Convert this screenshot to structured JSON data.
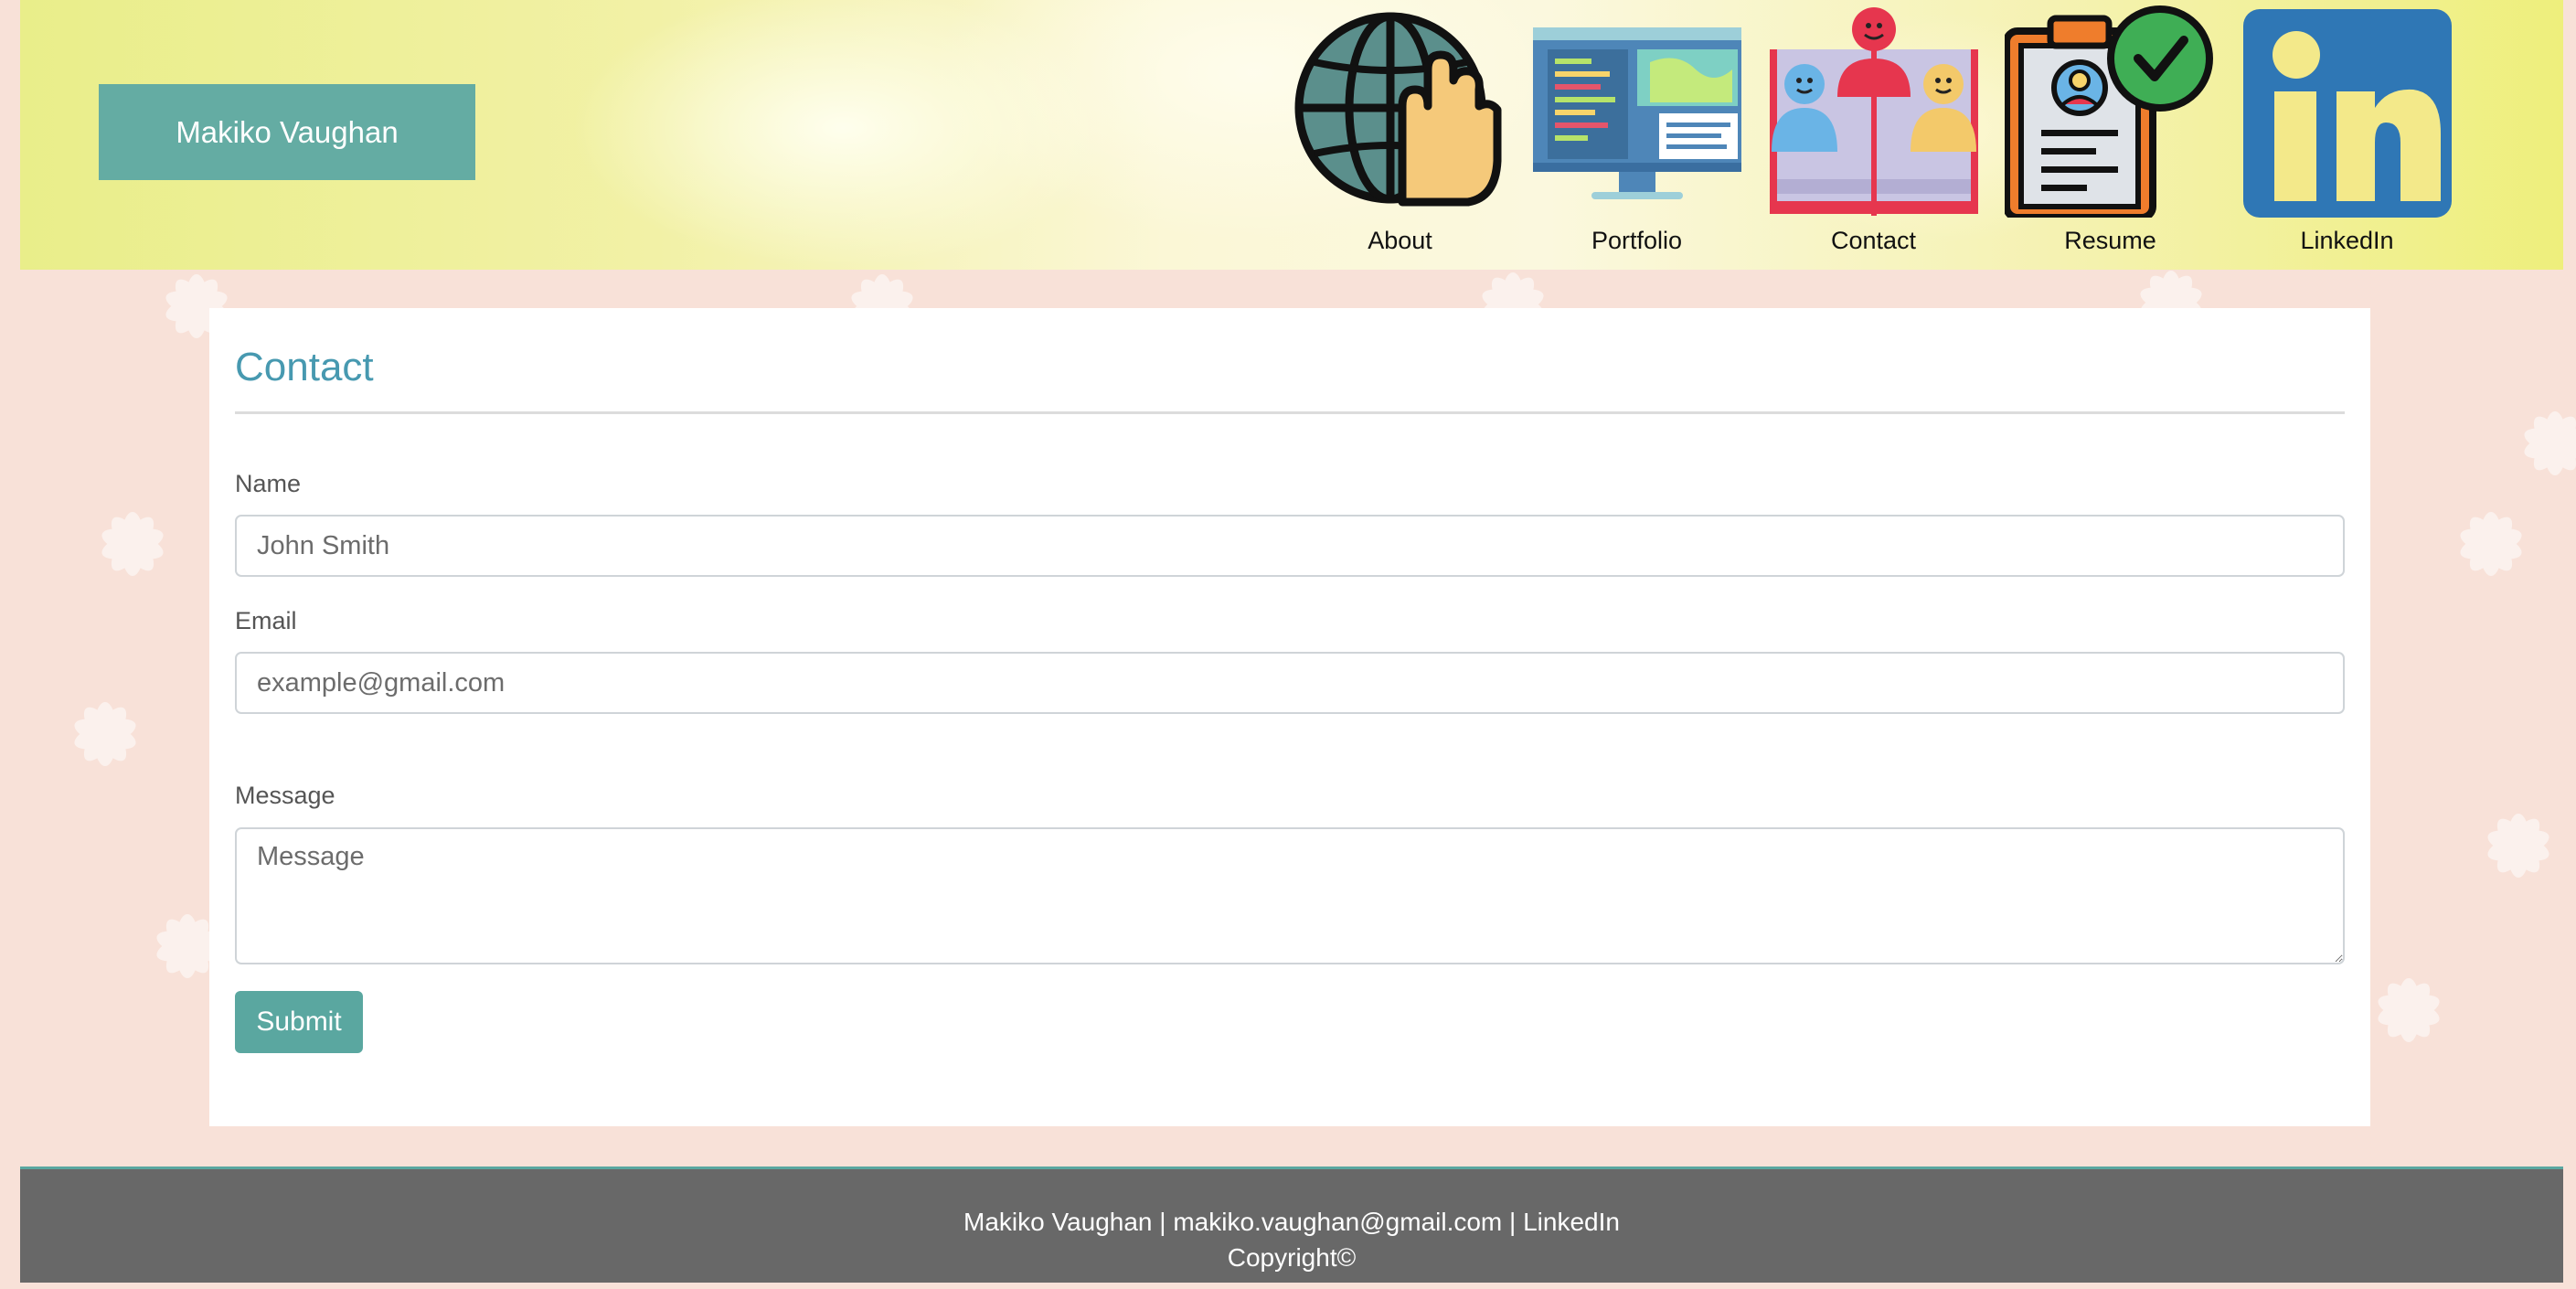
{
  "brand": {
    "name": "Makiko Vaughan"
  },
  "nav": {
    "items": [
      {
        "label": "About",
        "icon": "globe-hand-icon"
      },
      {
        "label": "Portfolio",
        "icon": "monitor-code-icon"
      },
      {
        "label": "Contact",
        "icon": "people-book-icon"
      },
      {
        "label": "Resume",
        "icon": "clipboard-check-icon"
      },
      {
        "label": "LinkedIn",
        "icon": "linkedin-icon"
      }
    ]
  },
  "contact": {
    "title": "Contact",
    "name_label": "Name",
    "name_placeholder": "John Smith",
    "email_label": "Email",
    "email_placeholder": "example@gmail.com",
    "message_label": "Message",
    "message_placeholder": "Message",
    "submit_label": "Submit"
  },
  "footer": {
    "name": "Makiko Vaughan",
    "sep1": " | ",
    "email": "makiko.vaughan@gmail.com",
    "sep2": " | ",
    "linkedin": "LinkedIn",
    "copyright": "Copyright©"
  },
  "colors": {
    "accent": "#64aca3",
    "title": "#4799b0",
    "footer_bg": "#686868",
    "page_bg": "#f8e1d8"
  }
}
